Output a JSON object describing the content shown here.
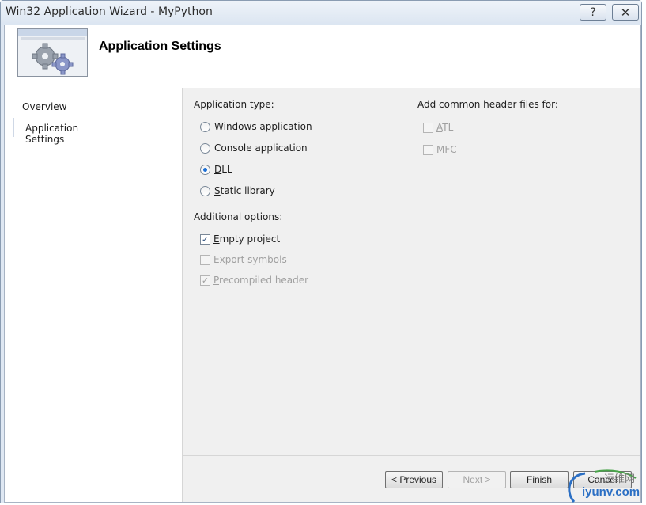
{
  "window": {
    "title": "Win32 Application Wizard - MyPython",
    "help_label": "?",
    "close_label": "✕"
  },
  "banner": {
    "title": "Application Settings"
  },
  "nav": {
    "items": [
      {
        "label": "Overview"
      },
      {
        "label": "Application Settings"
      }
    ]
  },
  "application_type": {
    "label": "Application type:",
    "options": [
      {
        "label": "Windows application",
        "checked": false
      },
      {
        "label": "Console application",
        "checked": false
      },
      {
        "label": "DLL",
        "checked": true
      },
      {
        "label": "Static library",
        "checked": false
      }
    ]
  },
  "additional_options": {
    "label": "Additional options:",
    "options": [
      {
        "label": "Empty project",
        "checked": true,
        "enabled": true
      },
      {
        "label": "Export symbols",
        "checked": false,
        "enabled": false
      },
      {
        "label": "Precompiled header",
        "checked": true,
        "enabled": false
      }
    ]
  },
  "common_headers": {
    "label": "Add common header files for:",
    "options": [
      {
        "label": "ATL",
        "checked": false,
        "enabled": false
      },
      {
        "label": "MFC",
        "checked": false,
        "enabled": false
      }
    ]
  },
  "buttons": {
    "previous": "< Previous",
    "next": "Next >",
    "finish": "Finish",
    "cancel": "Cancel"
  },
  "watermark": {
    "text": "iyunv.com",
    "cn": "运维网"
  },
  "colors": {
    "accent": "#1c6fd6",
    "disabled_text": "#a0a0a0"
  }
}
